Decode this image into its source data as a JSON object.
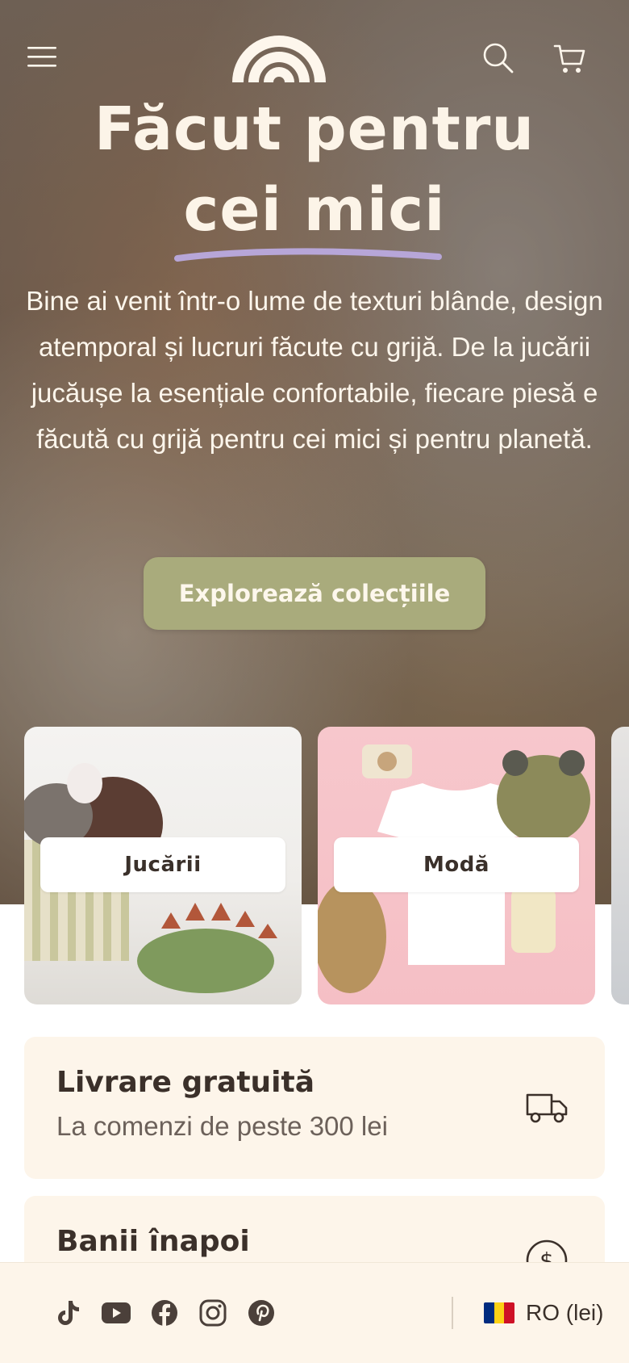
{
  "header": {
    "menu_icon": "hamburger-menu-icon",
    "logo_icon": "rainbow-logo-icon",
    "search_icon": "search-icon",
    "cart_icon": "cart-icon"
  },
  "hero": {
    "title_line1": "Făcut pentru",
    "title_line2": "cei mici",
    "description": "Bine ai venit într-o lume de texturi blânde, design atemporal și lucruri făcute cu grijă. De la jucării jucăușe la esențiale confortabile, fiecare piesă e făcută cu grijă pentru cei mici și pentru planetă.",
    "cta_label": "Explorează colecțiile",
    "accent_color": "#a9ab7c",
    "underline_color": "#b7a6d8"
  },
  "collections": [
    {
      "label": "Jucării"
    },
    {
      "label": "Modă"
    }
  ],
  "benefits": [
    {
      "title": "Livrare gratuită",
      "subtitle": "La comenzi de peste 300 lei",
      "icon": "truck-icon"
    },
    {
      "title": "Banii înapoi",
      "subtitle": "",
      "icon": "dollar-coin-icon"
    }
  ],
  "footer_bar": {
    "social_icons": [
      "tiktok-icon",
      "youtube-icon",
      "facebook-icon",
      "instagram-icon",
      "pinterest-icon"
    ],
    "locale_label": "RO (lei)",
    "flag_colors": [
      "#002b7f",
      "#fcd116",
      "#ce1126"
    ]
  }
}
